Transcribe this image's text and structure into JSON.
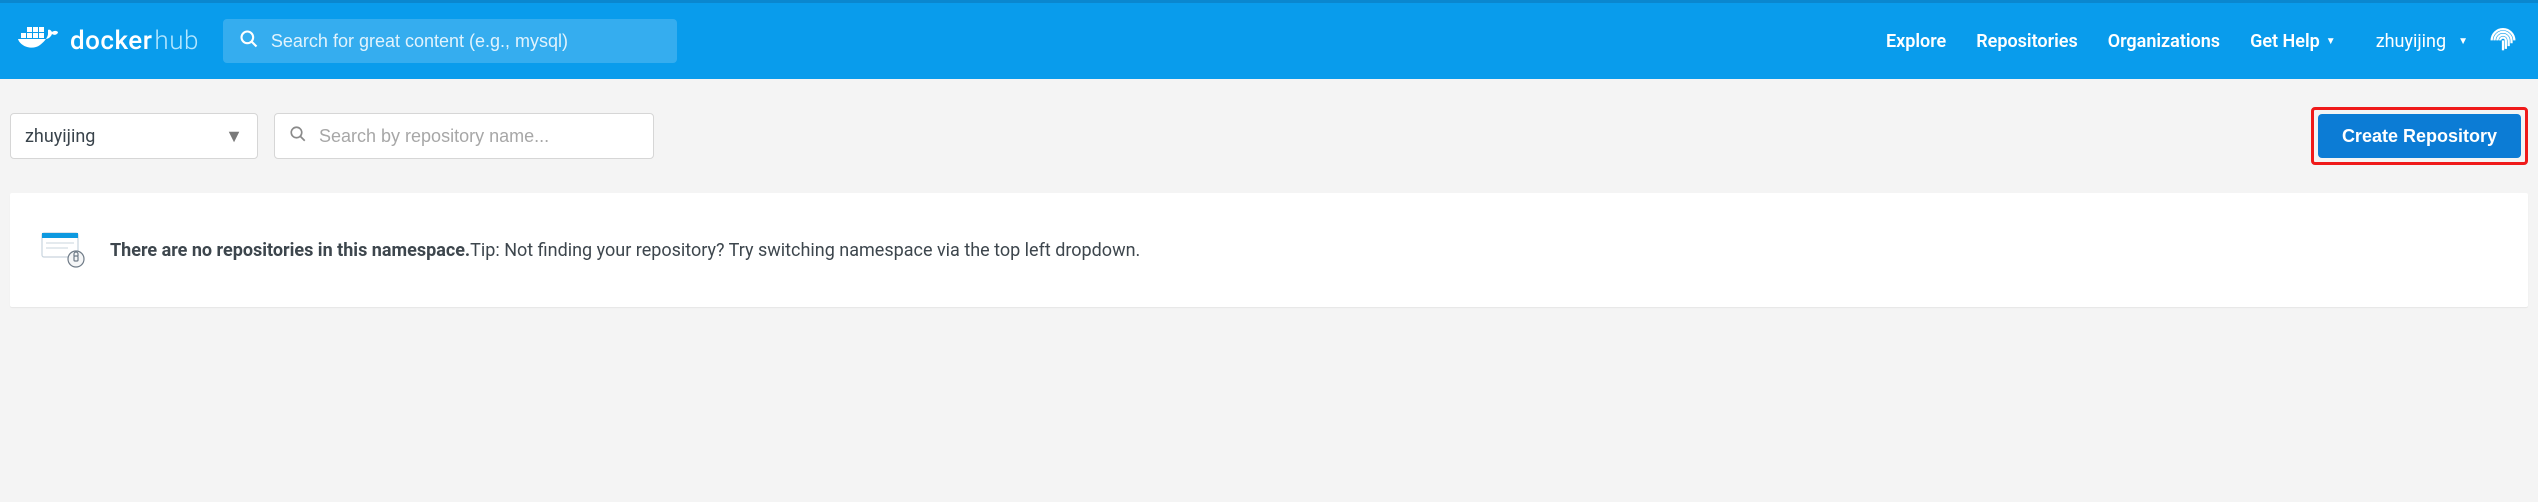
{
  "header": {
    "logo_main": "docker",
    "logo_sub": "hub",
    "search_placeholder": "Search for great content (e.g., mysql)"
  },
  "nav": {
    "explore": "Explore",
    "repositories": "Repositories",
    "organizations": "Organizations",
    "get_help": "Get Help"
  },
  "user": {
    "name": "zhuyijing"
  },
  "subbar": {
    "namespace": "zhuyijing",
    "repo_search_placeholder": "Search by repository name...",
    "create_label": "Create Repository"
  },
  "empty_state": {
    "heading": "There are no repositories in this namespace.",
    "tip": "Tip: Not finding your repository? Try switching namespace via the top left dropdown."
  }
}
